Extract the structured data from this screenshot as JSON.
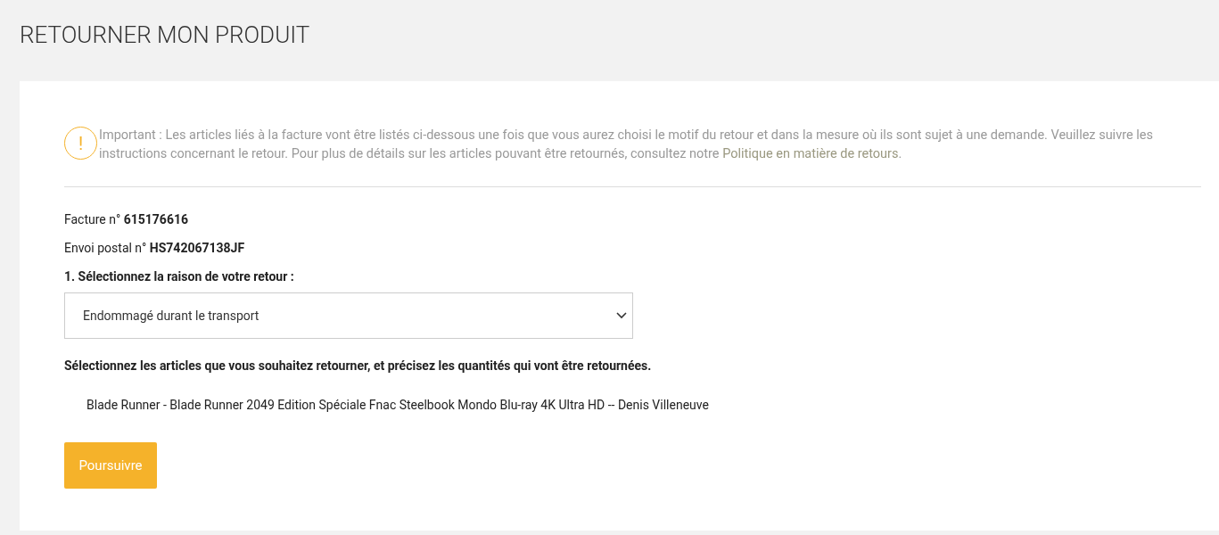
{
  "page_title": "RETOURNER MON PRODUIT",
  "notice": {
    "icon": "!",
    "text_before": "Important : Les articles liés à la facture vont être listés ci-dessous une fois que vous aurez choisi le motif du retour et dans la mesure où ils sont sujet à une demande. Veuillez suivre les instructions concernant le retour. Pour plus de détails sur les articles pouvant être retournés, consultez notre ",
    "link": "Politique en matière de retours",
    "text_after": "."
  },
  "invoice": "Facture n° **615176616**",
  "shipment": "Envoi postal n° **HS742067138JF**",
  "reason_label": "1. Sélectionnez la raison de votre retour :",
  "reason_select": {
    "value": "Endommagé durant le transport"
  },
  "items_label": "Sélectionnez les articles que vous souhaitez retourner, et précisez les quantités qui vont être retournées.",
  "items": [
    "Blade Runner - Blade Runner 2049 Edition Spéciale Fnac Steelbook Mondo Blu-ray 4K Ultra HD -- Denis Villeneuve"
  ],
  "continue_button": "Poursuivre"
}
